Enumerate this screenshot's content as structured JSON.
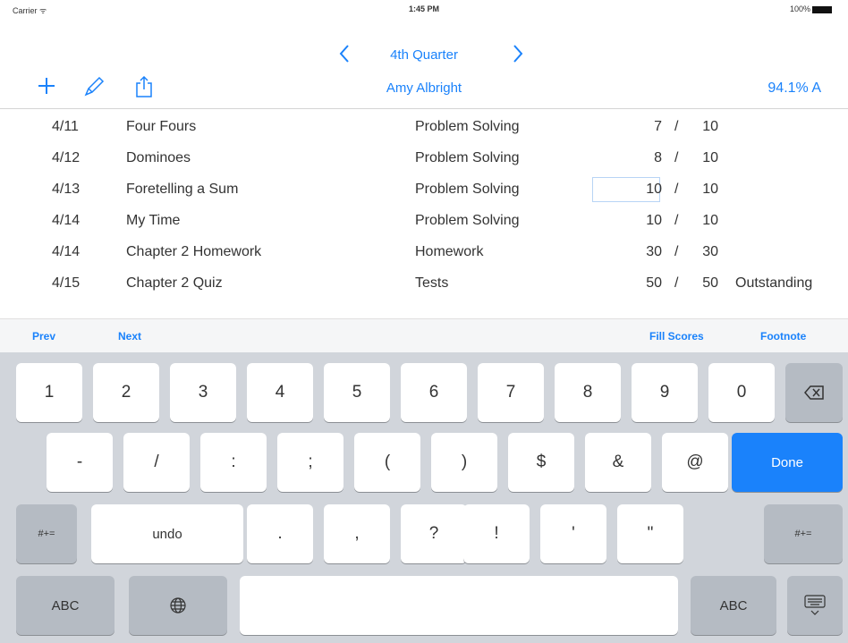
{
  "status_bar": {
    "carrier": "Carrier ᯤ",
    "time": "1:45 PM",
    "battery": "100%"
  },
  "nav": {
    "prev_icon": "chevron-left-icon",
    "next_icon": "chevron-right-icon",
    "quarter": "4th Quarter"
  },
  "toolbar": {
    "add_icon": "plus-icon",
    "edit_icon": "pencil-icon",
    "share_icon": "share-icon",
    "student_name": "Amy Albright",
    "grade": "94.1%  A"
  },
  "assignments": [
    {
      "date": "4/11",
      "name": "Four Fours",
      "category": "Problem Solving",
      "earned": "7",
      "slash": "/",
      "possible": "10",
      "note": ""
    },
    {
      "date": "4/12",
      "name": "Dominoes",
      "category": "Problem Solving",
      "earned": "8",
      "slash": "/",
      "possible": "10",
      "note": ""
    },
    {
      "date": "4/13",
      "name": "Foretelling a Sum",
      "category": "Problem Solving",
      "earned": "10",
      "slash": "/",
      "possible": "10",
      "note": ""
    },
    {
      "date": "4/14",
      "name": "My Time",
      "category": "Problem Solving",
      "earned": "10",
      "slash": "/",
      "possible": "10",
      "note": ""
    },
    {
      "date": "4/14",
      "name": "Chapter 2 Homework",
      "category": "Homework",
      "earned": "30",
      "slash": "/",
      "possible": "30",
      "note": ""
    },
    {
      "date": "4/15",
      "name": "Chapter 2 Quiz",
      "category": "Tests",
      "earned": "50",
      "slash": "/",
      "possible": "50",
      "note": "Outstanding"
    }
  ],
  "accessory": {
    "prev": "Prev",
    "next": "Next",
    "fill_scores": "Fill Scores",
    "footnote": "Footnote"
  },
  "keyboard": {
    "row1": [
      "1",
      "2",
      "3",
      "4",
      "5",
      "6",
      "7",
      "8",
      "9",
      "0"
    ],
    "delete_icon": "backspace-icon",
    "row2": [
      "-",
      "/",
      ":",
      ";",
      "(",
      ")",
      "$",
      "&",
      "@"
    ],
    "done": "Done",
    "symbols": "#+=",
    "undo": "undo",
    "row3": [
      ".",
      ",",
      "?",
      "!",
      "'",
      "\""
    ],
    "abc": "ABC",
    "globe_icon": "globe-icon",
    "hide_keyboard_icon": "keyboard-hide-icon"
  },
  "colors": {
    "accent": "#1a82fb",
    "keyboard_bg": "#d1d5db",
    "dark_key": "#b5bbc3"
  }
}
